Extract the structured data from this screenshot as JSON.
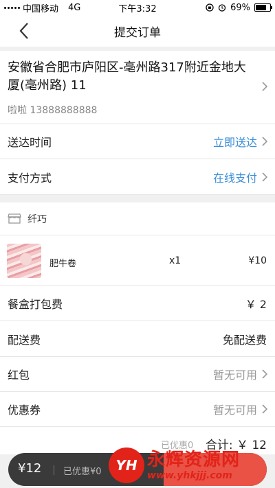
{
  "status_bar": {
    "carrier": "中国移动",
    "network": "4G",
    "time": "下午3:32",
    "battery": "69%",
    "battery_level": 0.69
  },
  "nav": {
    "title": "提交订单"
  },
  "address": {
    "text": "安徽省合肥市庐阳区-亳州路317附近金地大厦(亳州路) 11",
    "contact": "啦啦 13888888888"
  },
  "delivery": {
    "label": "送达时间",
    "value": "立即送达"
  },
  "payment": {
    "label": "支付方式",
    "value": "在线支付"
  },
  "shop": {
    "name": "纤巧"
  },
  "items": [
    {
      "name": "肥牛卷",
      "qty": "x1",
      "price": "¥10"
    }
  ],
  "fees": {
    "packaging": {
      "label": "餐盒打包费",
      "value": "￥ 2"
    },
    "shipping": {
      "label": "配送费",
      "value": "免配送费"
    }
  },
  "red_packet": {
    "label": "红包",
    "value": "暂无可用"
  },
  "coupon": {
    "label": "优惠券",
    "value": "暂无可用"
  },
  "summary": {
    "saved": "已优惠0",
    "total": "合计: ￥ 12"
  },
  "bottom_bar": {
    "price": "¥12",
    "saved": "已优惠¥0"
  },
  "watermark": {
    "logo": "YH",
    "title": "永辉资源网",
    "url": "www.yhkjjj.com"
  },
  "colors": {
    "accent_blue": "#3d8fd8",
    "submit_red": "#e95245"
  }
}
